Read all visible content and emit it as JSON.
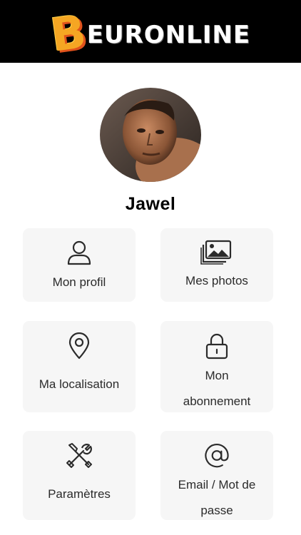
{
  "header": {
    "logo_initial": "B",
    "logo_rest": "EURONLINE",
    "background_color": "#000000",
    "logo_accent_color": "#f5a623"
  },
  "profile": {
    "username": "Jawel"
  },
  "menu": {
    "profile": {
      "label": "Mon profil",
      "icon": "user-icon"
    },
    "photos": {
      "label": "Mes photos",
      "icon": "photos-icon"
    },
    "location": {
      "label": "Ma localisation",
      "icon": "map-pin-icon"
    },
    "subscription": {
      "label_line1": "Mon",
      "label_line2": "abonnement",
      "icon": "lock-icon"
    },
    "settings": {
      "label": "Paramètres",
      "icon": "tools-icon"
    },
    "credentials": {
      "label_line1": "Email / Mot de",
      "label_line2": "passe",
      "icon": "at-icon"
    }
  },
  "colors": {
    "tile_background": "#f6f6f6",
    "text": "#2b2b2b"
  }
}
